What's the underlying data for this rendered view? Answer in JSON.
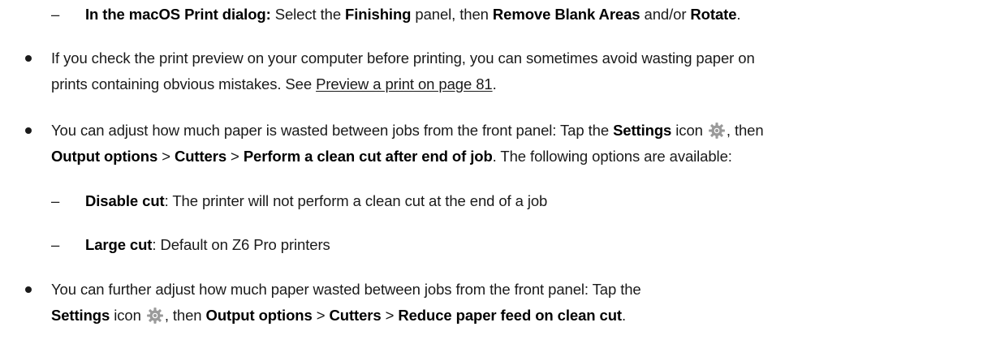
{
  "items": {
    "mac_dialog": {
      "dash": "–",
      "lead": "In the macOS Print dialog:",
      "t1": " Select the ",
      "finishing": "Finishing",
      "t2": " panel, then ",
      "remove_blank": "Remove Blank Areas",
      "t3": " and/or ",
      "rotate": "Rotate",
      "t4": "."
    },
    "preview": {
      "line1": "If you check the print preview on your computer before printing, you can sometimes avoid wasting paper on",
      "line2_a": "prints containing obvious mistakes. See ",
      "link": "Preview a print on page 81",
      "line2_b": "."
    },
    "cut_settings": {
      "l1_a": "You can adjust how much paper is wasted between jobs from the front panel: Tap the ",
      "settings": "Settings",
      "l1_b": "  icon ",
      "l1_c": ", then",
      "output_options": "Output options",
      "sep1": " > ",
      "cutters": "Cutters",
      "sep2": " > ",
      "perform_clean_cut": "Perform a clean cut after end of job",
      "l2_end": ". The following options are available:"
    },
    "disable_cut": {
      "dash": "–",
      "label": "Disable cut",
      "desc": ": The printer will not perform a clean cut at the end of a job"
    },
    "large_cut": {
      "dash": "–",
      "label": "Large cut",
      "desc": ": Default on Z6 Pro printers"
    },
    "reduce_feed": {
      "l1": "You can further adjust how much paper wasted between jobs from the front panel: Tap the",
      "settings": "Settings",
      "l2_a": "  icon ",
      "l2_b": ", then ",
      "output_options": "Output options",
      "sep1": " > ",
      "cutters": "Cutters",
      "sep2": " > ",
      "reduce": "Reduce paper feed on clean cut",
      "l2_end": "."
    }
  },
  "icons": {
    "bullet": "bullet-icon",
    "gear": "gear-icon",
    "gear_color": "#9a9a9a"
  }
}
